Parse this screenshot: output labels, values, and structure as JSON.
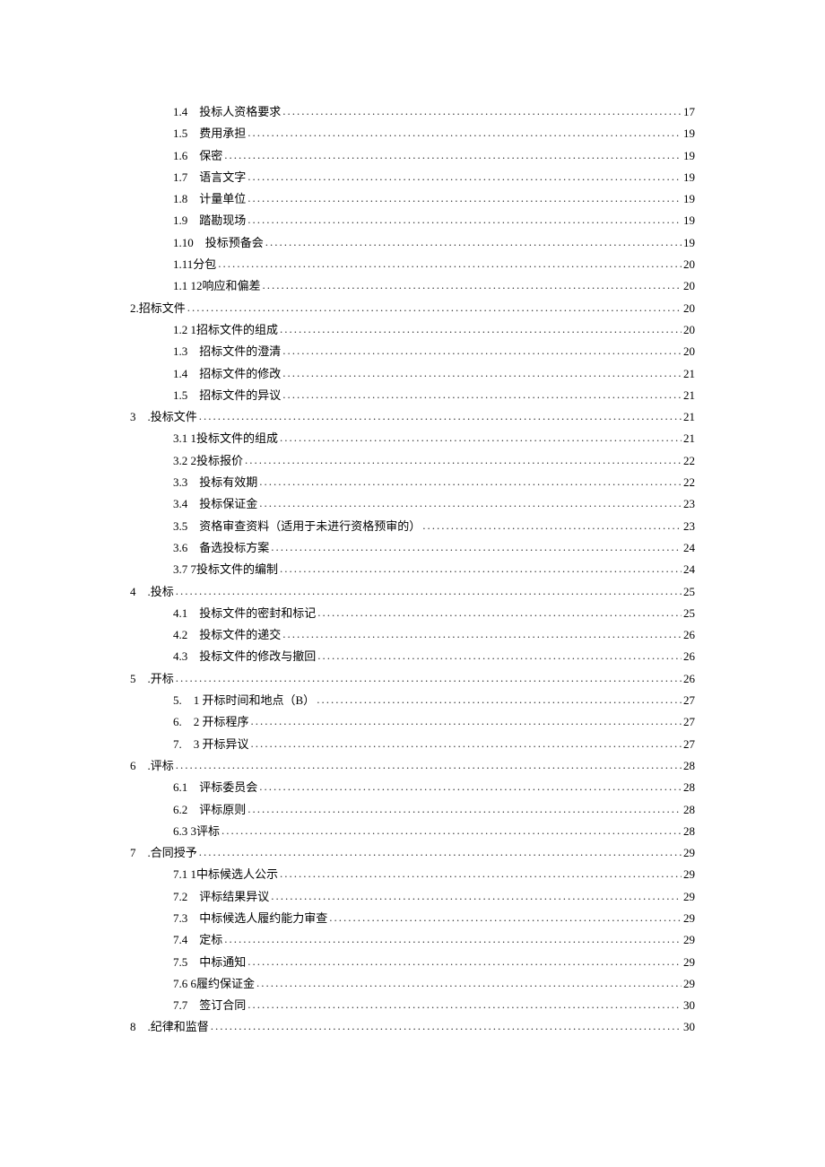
{
  "toc": [
    {
      "indent": 2,
      "num": "1.4",
      "gap": "　",
      "title": "投标人资格要求",
      "page": "17"
    },
    {
      "indent": 2,
      "num": "1.5",
      "gap": "　",
      "title": "费用承担",
      "page": "19"
    },
    {
      "indent": 2,
      "num": "1.6",
      "gap": "　",
      "title": "保密",
      "page": "19"
    },
    {
      "indent": 2,
      "num": "1.7",
      "gap": "　",
      "title": "语言文字",
      "page": "19"
    },
    {
      "indent": 2,
      "num": "1.8",
      "gap": "　",
      "title": "计量单位",
      "page": "19"
    },
    {
      "indent": 2,
      "num": "1.9",
      "gap": "　",
      "title": "踏勘现场",
      "page": "19"
    },
    {
      "indent": 2,
      "num": "1.10",
      "gap": "　",
      "title": "投标预备会",
      "page": "19"
    },
    {
      "indent": 2,
      "num": "1.11",
      "gap": " ",
      "title": "分包",
      "page": "20"
    },
    {
      "indent": 2,
      "num": "1.1 12",
      "gap": " ",
      "title": "响应和偏差",
      "page": "20"
    },
    {
      "indent": 1,
      "num": "2.",
      "gap": "",
      "title": "招标文件",
      "page": "20"
    },
    {
      "indent": 2,
      "num": "1.2 1",
      "gap": " ",
      "title": "招标文件的组成",
      "page": "20"
    },
    {
      "indent": 2,
      "num": "1.3",
      "gap": "　",
      "title": "招标文件的澄清",
      "page": "20"
    },
    {
      "indent": 2,
      "num": "1.4",
      "gap": "　",
      "title": "招标文件的修改",
      "page": "21"
    },
    {
      "indent": 2,
      "num": "1.5",
      "gap": "　",
      "title": "招标文件的异议",
      "page": "21"
    },
    {
      "indent": 1,
      "num": "3",
      "gap": "　.",
      "title": "投标文件",
      "page": "21"
    },
    {
      "indent": 2,
      "num": "3.1 1",
      "gap": " ",
      "title": "投标文件的组成",
      "page": "21"
    },
    {
      "indent": 2,
      "num": "3.2 2",
      "gap": " ",
      "title": "投标报价",
      "page": "22"
    },
    {
      "indent": 2,
      "num": "3.3",
      "gap": "　",
      "title": "投标有效期",
      "page": "22"
    },
    {
      "indent": 2,
      "num": "3.4",
      "gap": "　",
      "title": "投标保证金",
      "page": "23"
    },
    {
      "indent": 2,
      "num": "3.5",
      "gap": "　",
      "title": "资格审查资料（适用于未进行资格预审的）",
      "page": "23"
    },
    {
      "indent": 2,
      "num": "3.6",
      "gap": "　",
      "title": "备选投标方案",
      "page": "24"
    },
    {
      "indent": 2,
      "num": "3.7 7",
      "gap": " ",
      "title": "投标文件的编制",
      "page": "24"
    },
    {
      "indent": 1,
      "num": "4",
      "gap": "　.",
      "title": "投标",
      "page": "25"
    },
    {
      "indent": 2,
      "num": "4.1",
      "gap": "　",
      "title": "投标文件的密封和标记",
      "page": "25"
    },
    {
      "indent": 2,
      "num": "4.2",
      "gap": "　",
      "title": "投标文件的递交",
      "page": "26"
    },
    {
      "indent": 2,
      "num": "4.3",
      "gap": "　",
      "title": "投标文件的修改与撤回",
      "page": "26"
    },
    {
      "indent": 1,
      "num": "5",
      "gap": "　.",
      "title": "开标",
      "page": "26"
    },
    {
      "indent": 2,
      "num": "5.",
      "gap": "　",
      "title": "1 开标时间和地点（B）",
      "page": "27"
    },
    {
      "indent": 2,
      "num": "6.",
      "gap": "　",
      "title": "2 开标程序",
      "page": "27"
    },
    {
      "indent": 2,
      "num": "7.",
      "gap": "　",
      "title": "3 开标异议",
      "page": "27"
    },
    {
      "indent": 1,
      "num": "6",
      "gap": "　.",
      "title": "评标",
      "page": "28"
    },
    {
      "indent": 2,
      "num": "6.1",
      "gap": "　",
      "title": "评标委员会",
      "page": "28"
    },
    {
      "indent": 2,
      "num": "6.2",
      "gap": "　",
      "title": "评标原则",
      "page": "28"
    },
    {
      "indent": 2,
      "num": "6.3 3",
      "gap": " ",
      "title": "评标",
      "page": "28"
    },
    {
      "indent": 1,
      "num": "7",
      "gap": "　.",
      "title": "合同授予",
      "page": "29"
    },
    {
      "indent": 2,
      "num": "7.1 1",
      "gap": " ",
      "title": "中标候选人公示",
      "page": "29"
    },
    {
      "indent": 2,
      "num": "7.2",
      "gap": "　",
      "title": "评标结果异议",
      "page": "29"
    },
    {
      "indent": 2,
      "num": "7.3",
      "gap": "　",
      "title": "中标候选人履约能力审查",
      "page": "29"
    },
    {
      "indent": 2,
      "num": "7.4",
      "gap": "　",
      "title": "定标",
      "page": "29"
    },
    {
      "indent": 2,
      "num": "7.5",
      "gap": "　",
      "title": "中标通知",
      "page": "29"
    },
    {
      "indent": 2,
      "num": "7.6 6",
      "gap": " ",
      "title": "履约保证金",
      "page": "29"
    },
    {
      "indent": 2,
      "num": "7.7",
      "gap": "　",
      "title": "签订合同",
      "page": "30"
    },
    {
      "indent": 1,
      "num": "8",
      "gap": "　.",
      "title": "纪律和监督",
      "page": "30"
    }
  ]
}
